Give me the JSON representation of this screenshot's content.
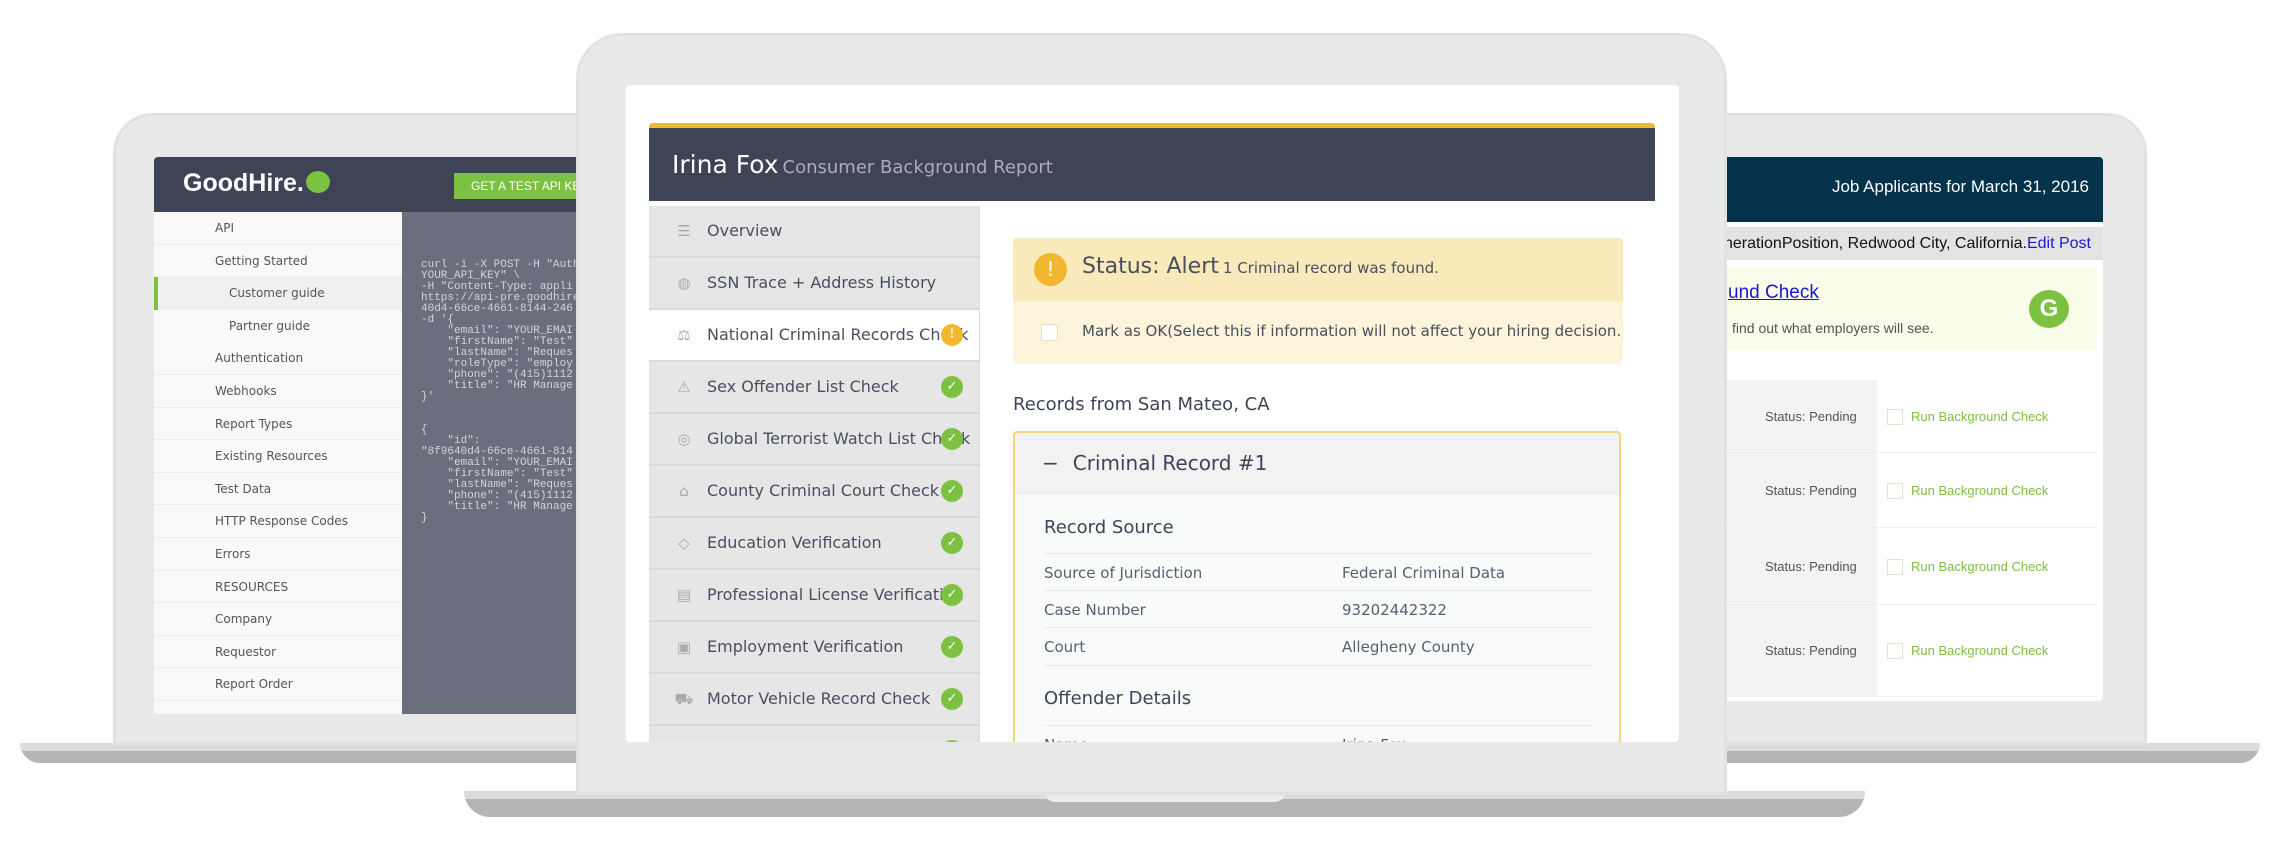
{
  "left_laptop": {
    "logo": "GoodHire.",
    "api_key_button": "GET A TEST API KEY",
    "nav": [
      {
        "label": "API",
        "type": "item"
      },
      {
        "label": "Getting Started",
        "type": "item"
      },
      {
        "label": "Customer guide",
        "type": "sub",
        "selected": true
      },
      {
        "label": "Partner guide",
        "type": "sub"
      },
      {
        "label": "Authentication",
        "type": "item"
      },
      {
        "label": "Webhooks",
        "type": "item"
      },
      {
        "label": "Report Types",
        "type": "item"
      },
      {
        "label": "Existing Resources",
        "type": "item"
      },
      {
        "label": "Test Data",
        "type": "item"
      },
      {
        "label": "HTTP Response Codes",
        "type": "item"
      },
      {
        "label": "Errors",
        "type": "item"
      },
      {
        "label": "RESOURCES",
        "type": "item"
      },
      {
        "label": "Company",
        "type": "item"
      },
      {
        "label": "Requestor",
        "type": "item"
      },
      {
        "label": "Report Order",
        "type": "item"
      }
    ],
    "code": "curl -i -X POST -H \"Auth\nYOUR_API_KEY\" \\\n-H \"Content-Type: appli\nhttps://api-pre.goodhire\n40d4-66ce-4661-8144-246\n-d '{\n    \"email\": \"YOUR_EMAI\n    \"firstName\": \"Test\"\n    \"lastName\": \"Reques\n    \"roleType\": \"employ\n    \"phone\": \"(415)1112\n    \"title\": \"HR Manage\n}'\n\n\n{\n    \"id\":\n\"8f9640d4-66ce-4661-814\n    \"email\": \"YOUR_EMAI\n    \"firstName\": \"Test\"\n    \"lastName\": \"Reques\n    \"phone\": \"(415)1112\n    \"title\": \"HR Manage\n}"
  },
  "report": {
    "name": "Irina Fox",
    "subtitle": "Consumer Background Report",
    "nav": [
      {
        "label": "Overview",
        "icon": "list-icon",
        "glyph": "☰",
        "status": "none"
      },
      {
        "label": "SSN Trace + Address History",
        "icon": "fingerprint-icon",
        "glyph": "◍",
        "status": "none"
      },
      {
        "label": "National Criminal Records Check",
        "icon": "scales-icon",
        "glyph": "⚖",
        "status": "alert",
        "active": true
      },
      {
        "label": "Sex Offender List Check",
        "icon": "warning-icon",
        "glyph": "⚠",
        "status": "ok"
      },
      {
        "label": "Global Terrorist Watch List Check",
        "icon": "eye-icon",
        "glyph": "◎",
        "status": "ok"
      },
      {
        "label": "County Criminal Court Check",
        "icon": "courthouse-icon",
        "glyph": "⌂",
        "status": "ok"
      },
      {
        "label": "Education Verification",
        "icon": "graduation-cap-icon",
        "glyph": "◇",
        "status": "ok"
      },
      {
        "label": "Professional License Verification",
        "icon": "license-icon",
        "glyph": "▤",
        "status": "ok"
      },
      {
        "label": "Employment Verification",
        "icon": "briefcase-icon",
        "glyph": "▣",
        "status": "ok"
      },
      {
        "label": "Motor Vehicle Record Check",
        "icon": "truck-icon",
        "glyph": "⛟",
        "status": "ok"
      },
      {
        "label": "",
        "icon": "",
        "glyph": "",
        "status": "ok"
      }
    ],
    "alert": {
      "status": "Status: Alert",
      "message": "1 Criminal record was found.",
      "mark_ok": "Mark as OK",
      "mark_ok_hint": "(Select this if information will not affect your hiring decision.)"
    },
    "records_heading": "Records from San Mateo, CA",
    "record": {
      "title": "Criminal Record #1",
      "source_heading": "Record Source",
      "source_rows": [
        {
          "label": "Source of Jurisdiction",
          "value": "Federal Criminal Data"
        },
        {
          "label": "Case Number",
          "value": "93202442322"
        },
        {
          "label": "Court",
          "value": "Allegheny County"
        }
      ],
      "offender_heading": "Offender Details",
      "offender_rows": [
        {
          "label": "Name",
          "value": "Irina Fox"
        }
      ]
    }
  },
  "right_laptop": {
    "title": "Job Applicants for March 31, 2016",
    "position_prefix": "neration",
    "position": "Position, Redwood City, California.",
    "edit_post": "Edit Post",
    "banner_link": "und Check",
    "banner_text": "find out what employers will see.",
    "logo_letter": "G",
    "rows": [
      {
        "status": "Status: Pending",
        "action": "Run Background Check"
      },
      {
        "status": "Status: Pending",
        "action": "Run Background Check"
      },
      {
        "status": "Status: Pending",
        "action": "Run Background Check"
      },
      {
        "status": "Status: Pending",
        "action": "Run Background Check"
      }
    ]
  },
  "colors": {
    "brand_green": "#7cc142",
    "alert_orange": "#f0b72f",
    "header_dark": "#3e4456",
    "right_header": "#04324a"
  }
}
